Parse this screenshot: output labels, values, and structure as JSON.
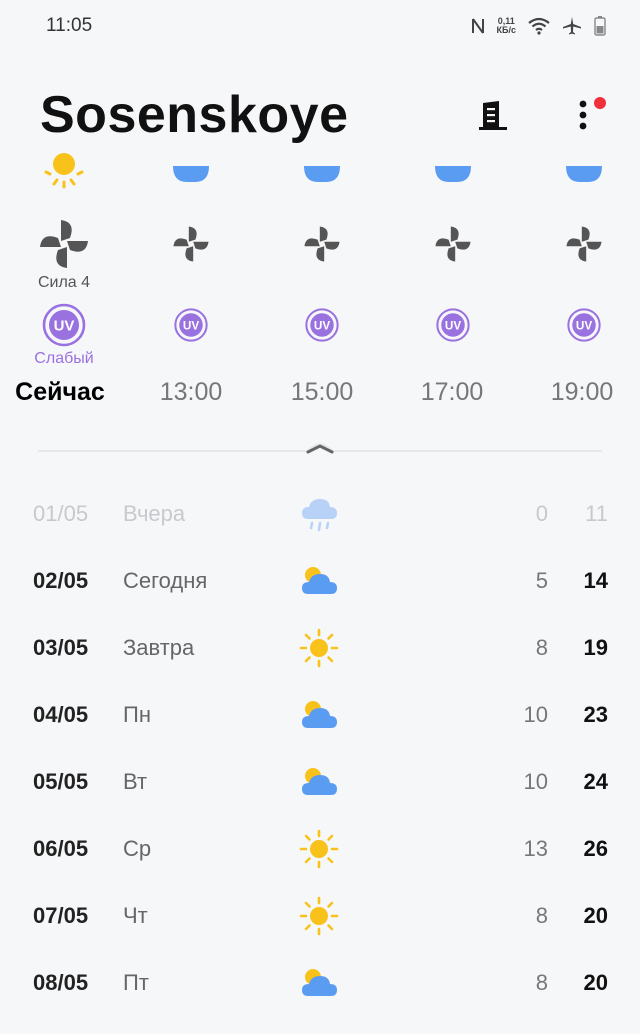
{
  "status": {
    "time": "11:05",
    "net_speed_value": "0,11",
    "net_speed_unit": "КБ/с"
  },
  "header": {
    "city": "Sosenskoye"
  },
  "hourly": [
    {
      "time": "Сейчас",
      "now": true,
      "wind_label": "Сила 4",
      "uv_label": "Слабый",
      "top_icon": "sun-icon"
    },
    {
      "time": "13:00",
      "now": false,
      "wind_label": "",
      "uv_label": "",
      "top_icon": "cloud-icon"
    },
    {
      "time": "15:00",
      "now": false,
      "wind_label": "",
      "uv_label": "",
      "top_icon": "cloud-icon"
    },
    {
      "time": "17:00",
      "now": false,
      "wind_label": "",
      "uv_label": "",
      "top_icon": "cloud-icon"
    },
    {
      "time": "19:00",
      "now": false,
      "wind_label": "",
      "uv_label": "",
      "top_icon": "cloud-icon"
    }
  ],
  "uv_text": "UV",
  "daily": [
    {
      "date": "01/05",
      "name": "Вчера",
      "icon": "rain-cloud-icon",
      "min": "0",
      "max": "11",
      "past": true
    },
    {
      "date": "02/05",
      "name": "Сегодня",
      "icon": "partly-cloudy-icon",
      "min": "5",
      "max": "14",
      "past": false
    },
    {
      "date": "03/05",
      "name": "Завтра",
      "icon": "sun-icon",
      "min": "8",
      "max": "19",
      "past": false
    },
    {
      "date": "04/05",
      "name": "Пн",
      "icon": "partly-cloudy-icon",
      "min": "10",
      "max": "23",
      "past": false
    },
    {
      "date": "05/05",
      "name": "Вт",
      "icon": "partly-cloudy-icon",
      "min": "10",
      "max": "24",
      "past": false
    },
    {
      "date": "06/05",
      "name": "Ср",
      "icon": "sun-icon",
      "min": "13",
      "max": "26",
      "past": false
    },
    {
      "date": "07/05",
      "name": "Чт",
      "icon": "sun-icon",
      "min": "8",
      "max": "20",
      "past": false
    },
    {
      "date": "08/05",
      "name": "Пт",
      "icon": "partly-cloudy-icon",
      "min": "8",
      "max": "20",
      "past": false
    }
  ],
  "colors": {
    "accent_uv": "#9a72e0",
    "sun": "#f8c21a",
    "cloud": "#5b9cf3",
    "notification": "#f0303a"
  }
}
